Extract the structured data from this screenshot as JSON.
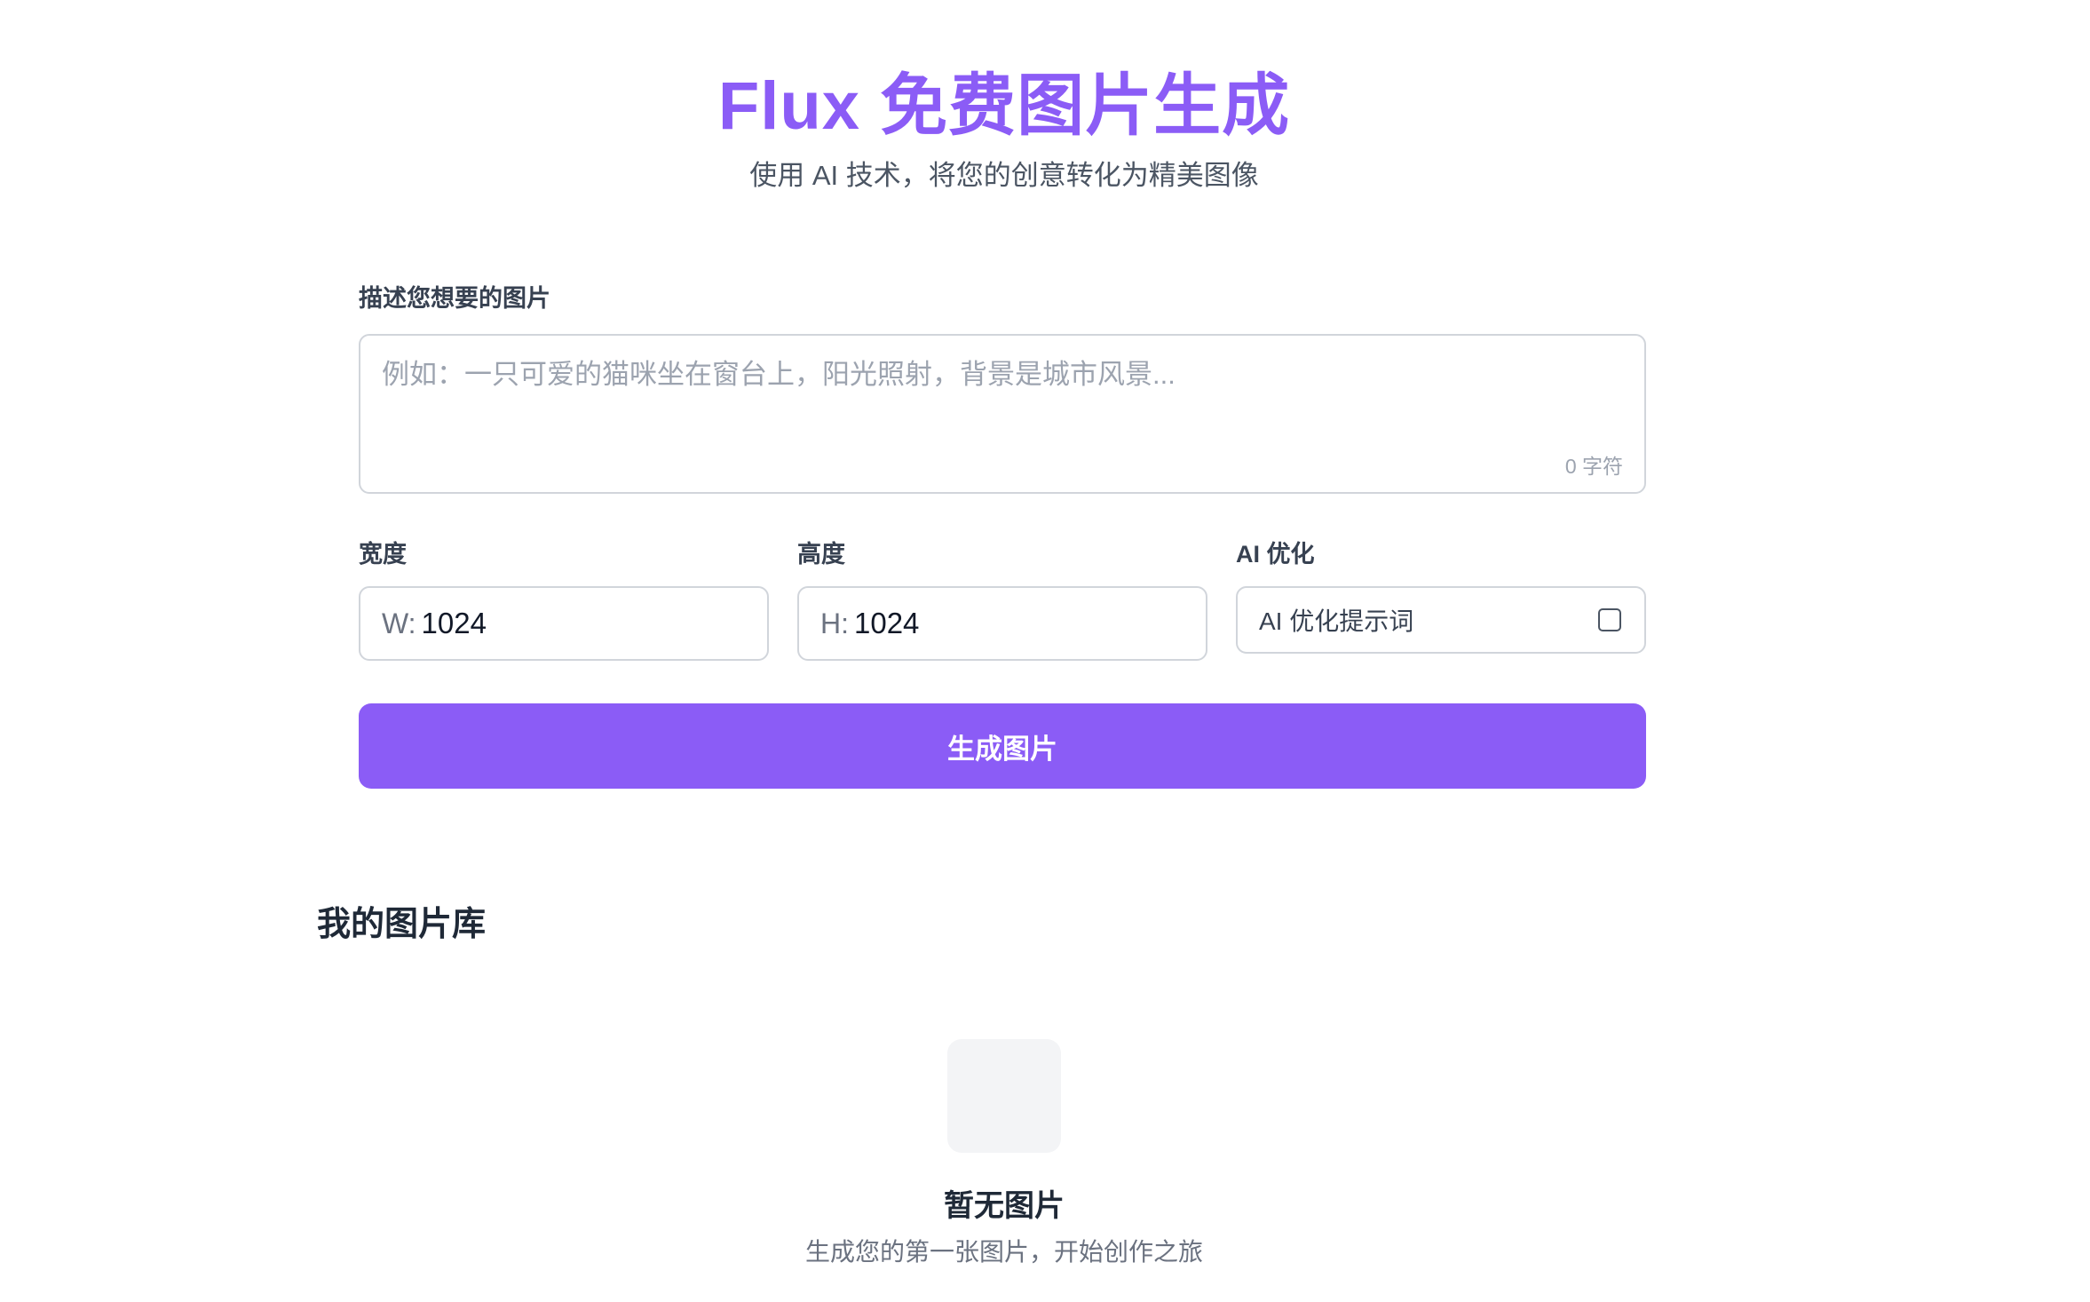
{
  "header": {
    "title": "Flux 免费图片生成",
    "subtitle": "使用 AI 技术，将您的创意转化为精美图像"
  },
  "prompt": {
    "label": "描述您想要的图片",
    "value": "",
    "placeholder": "例如：一只可爱的猫咪坐在窗台上，阳光照射，背景是城市风景...",
    "char_count": "0 字符"
  },
  "width": {
    "label": "宽度",
    "prefix": "W:",
    "value": "1024"
  },
  "height": {
    "label": "高度",
    "prefix": "H:",
    "value": "1024"
  },
  "ai_optimize": {
    "label": "AI 优化",
    "option_label": "AI 优化提示词",
    "checked": false
  },
  "generate_button": {
    "label": "生成图片"
  },
  "gallery": {
    "title": "我的图片库",
    "empty_title": "暂无图片",
    "empty_description": "生成您的第一张图片，开始创作之旅"
  },
  "colors": {
    "accent": "#8b5cf6",
    "border": "#d1d5db",
    "muted_text": "#6b7280"
  }
}
